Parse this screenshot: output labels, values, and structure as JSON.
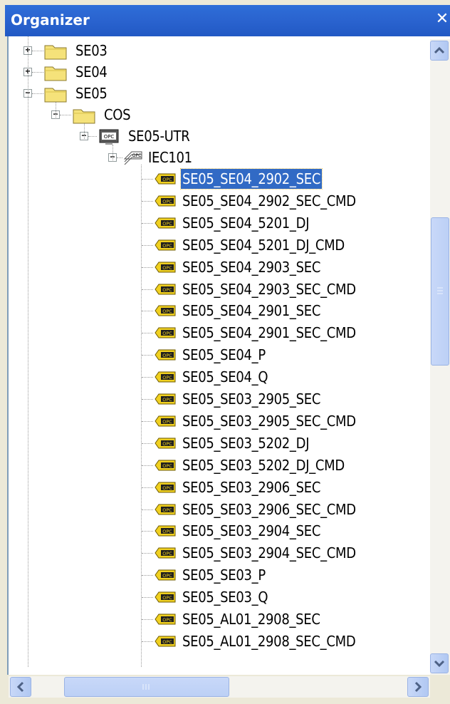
{
  "window": {
    "title": "Organizer",
    "close_glyph": "✕"
  },
  "tree": {
    "folders": [
      {
        "label": "SE03",
        "expander": "+"
      },
      {
        "label": "SE04",
        "expander": "+"
      },
      {
        "label": "SE05",
        "expander": "−"
      },
      {
        "label": "COS",
        "expander": "−"
      }
    ],
    "server": {
      "label": "SE05-UTR",
      "expander": "−",
      "icon": "opc-server-icon"
    },
    "channel": {
      "label": "IEC101",
      "expander": "−",
      "icon": "opc-channel-icon"
    },
    "items": [
      {
        "label": "SE05_SE04_2902_SEC",
        "selected": true
      },
      {
        "label": "SE05_SE04_2902_SEC_CMD"
      },
      {
        "label": "SE05_SE04_5201_DJ"
      },
      {
        "label": "SE05_SE04_5201_DJ_CMD"
      },
      {
        "label": "SE05_SE04_2903_SEC"
      },
      {
        "label": "SE05_SE04_2903_SEC_CMD"
      },
      {
        "label": "SE05_SE04_2901_SEC"
      },
      {
        "label": "SE05_SE04_2901_SEC_CMD"
      },
      {
        "label": "SE05_SE04_P"
      },
      {
        "label": "SE05_SE04_Q"
      },
      {
        "label": "SE05_SE03_2905_SEC"
      },
      {
        "label": "SE05_SE03_2905_SEC_CMD"
      },
      {
        "label": "SE05_SE03_5202_DJ"
      },
      {
        "label": "SE05_SE03_5202_DJ_CMD"
      },
      {
        "label": "SE05_SE03_2906_SEC"
      },
      {
        "label": "SE05_SE03_2906_SEC_CMD"
      },
      {
        "label": "SE05_SE03_2904_SEC"
      },
      {
        "label": "SE05_SE03_2904_SEC_CMD"
      },
      {
        "label": "SE05_SE03_P"
      },
      {
        "label": "SE05_SE03_Q"
      },
      {
        "label": "SE05_AL01_2908_SEC"
      },
      {
        "label": "SE05_AL01_2908_SEC_CMD"
      }
    ],
    "item_icon": "opc-tag-icon",
    "selection_color": "#316ac5"
  },
  "scrollbars": {
    "vertical": {
      "position_fraction": 0.35
    },
    "horizontal": {
      "position_fraction": 0.0
    }
  }
}
